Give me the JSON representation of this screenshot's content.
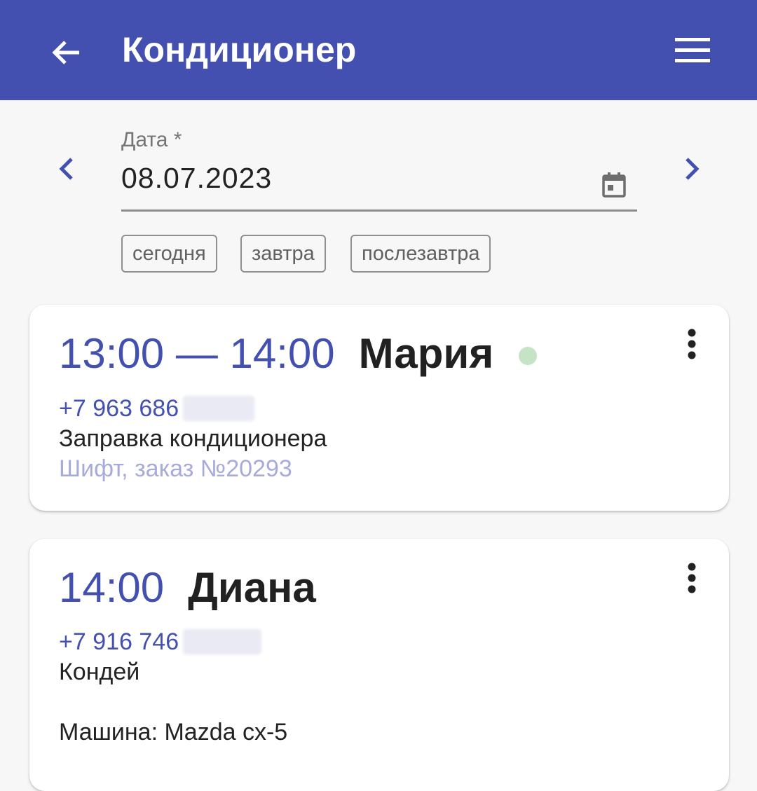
{
  "app_bar": {
    "title": "Кондиционер",
    "back_icon": "arrow-left-icon",
    "menu_icon": "hamburger-menu-icon",
    "background": "#4350b0"
  },
  "date_picker": {
    "label": "Дата *",
    "value": "08.07.2023",
    "prev_icon": "chevron-left-icon",
    "next_icon": "chevron-right-icon",
    "calendar_icon": "calendar-icon"
  },
  "quick_dates": [
    {
      "label": "сегодня"
    },
    {
      "label": "завтра"
    },
    {
      "label": "послезавтра"
    }
  ],
  "appointments": [
    {
      "time": "13:00 — 14:00",
      "name": "Мария",
      "status_color": "#c5e3c5",
      "phone": "+7 963 686",
      "service": "Заправка кондиционера",
      "source": "Шифт, заказ №20293"
    },
    {
      "time": "14:00",
      "name": "Диана",
      "phone": "+7 916 746",
      "service": "Кондей",
      "car": "Машина: Mazda cx-5"
    }
  ],
  "colors": {
    "accent": "#4350b0",
    "muted_accent": "#a6abdb",
    "background": "#f7f7f7"
  }
}
